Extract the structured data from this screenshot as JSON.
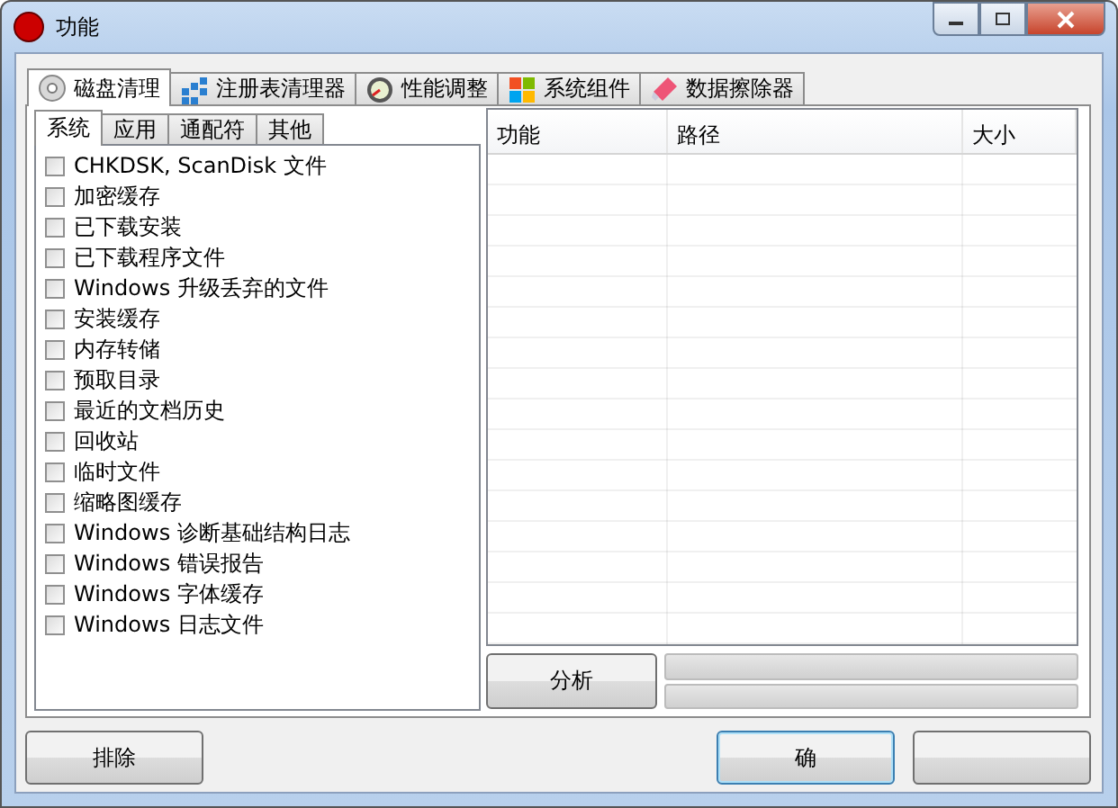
{
  "window": {
    "title": "功能"
  },
  "tabs": [
    {
      "label": "磁盘清理",
      "selected": true
    },
    {
      "label": "注册表清理器",
      "selected": false
    },
    {
      "label": "性能调整",
      "selected": false
    },
    {
      "label": "系统组件",
      "selected": false
    },
    {
      "label": "数据擦除器",
      "selected": false
    }
  ],
  "sub_tabs": [
    {
      "label": "系统",
      "selected": true
    },
    {
      "label": "应用",
      "selected": false
    },
    {
      "label": "通配符",
      "selected": false
    },
    {
      "label": "其他",
      "selected": false
    }
  ],
  "items": [
    {
      "label": "CHKDSK, ScanDisk 文件",
      "checked": false
    },
    {
      "label": "加密缓存",
      "checked": false
    },
    {
      "label": "已下载安装",
      "checked": false
    },
    {
      "label": "已下载程序文件",
      "checked": false
    },
    {
      "label": "Windows 升级丢弃的文件",
      "checked": false
    },
    {
      "label": "安装缓存",
      "checked": false
    },
    {
      "label": "内存转储",
      "checked": false
    },
    {
      "label": "预取目录",
      "checked": false
    },
    {
      "label": "最近的文档历史",
      "checked": false
    },
    {
      "label": "回收站",
      "checked": false
    },
    {
      "label": "临时文件",
      "checked": false
    },
    {
      "label": "缩略图缓存",
      "checked": false
    },
    {
      "label": "Windows 诊断基础结构日志",
      "checked": false
    },
    {
      "label": "Windows 错误报告",
      "checked": false
    },
    {
      "label": "Windows 字体缓存",
      "checked": false
    },
    {
      "label": "Windows 日志文件",
      "checked": false
    }
  ],
  "table": {
    "columns": [
      "功能",
      "路径",
      "大小"
    ]
  },
  "analyze_button": "分析",
  "progress": [
    {
      "level": 0
    },
    {
      "level": 0
    }
  ],
  "buttons": {
    "exclude": "排除",
    "ok": "确"
  }
}
